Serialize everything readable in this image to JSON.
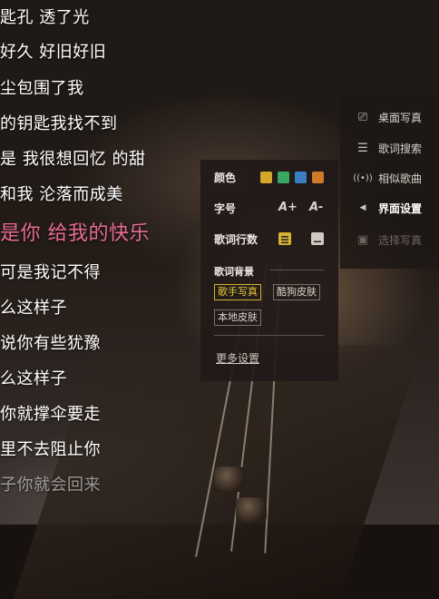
{
  "lyrics": [
    {
      "text": "匙孔 透了光",
      "state": "dim"
    },
    {
      "text": "好久 好旧好旧",
      "state": "normal"
    },
    {
      "text": "尘包围了我",
      "state": "normal"
    },
    {
      "text": "的钥匙我找不到",
      "state": "normal"
    },
    {
      "text": "是 我很想回忆 的甜",
      "state": "normal"
    },
    {
      "text": "和我 沦落而成美",
      "state": "normal"
    },
    {
      "text": "是你 给我的快乐",
      "state": "current"
    },
    {
      "text": "可是我记不得",
      "state": "normal"
    },
    {
      "text": "么这样子",
      "state": "normal"
    },
    {
      "text": "说你有些犹豫",
      "state": "normal"
    },
    {
      "text": "么这样子",
      "state": "normal"
    },
    {
      "text": "你就撑伞要走",
      "state": "normal"
    },
    {
      "text": "里不去阻止你",
      "state": "normal"
    },
    {
      "text": "子你就会回来",
      "state": "dim"
    }
  ],
  "right_menu": [
    {
      "icon": "desktop-photo-icon",
      "glyph": "⎚",
      "label": "桌面写真",
      "state": "normal"
    },
    {
      "icon": "lyric-search-icon",
      "glyph": "☰",
      "label": "歌词搜索",
      "state": "normal"
    },
    {
      "icon": "similar-songs-icon",
      "glyph": "((•))",
      "label": "相似歌曲",
      "state": "normal"
    },
    {
      "icon": "interface-settings-icon",
      "glyph": "◀",
      "label": "界面设置",
      "state": "active"
    },
    {
      "icon": "select-photo-icon",
      "glyph": "▣",
      "label": "选择写真",
      "state": "disabled"
    }
  ],
  "settings": {
    "color_label": "颜色",
    "colors": [
      "#d5a52c",
      "#3aa862",
      "#3a7fc1",
      "#d07a2a"
    ],
    "font_size_label": "字号",
    "font_increase": "A+",
    "font_decrease": "A-",
    "lyric_lines_label": "歌词行数",
    "background_label": "歌词背景",
    "bg_options": [
      {
        "label": "歌手写真",
        "selected": true
      },
      {
        "label": "酷狗皮肤",
        "selected": false
      },
      {
        "label": "本地皮肤",
        "selected": false
      }
    ],
    "more_settings": "更多设置"
  }
}
